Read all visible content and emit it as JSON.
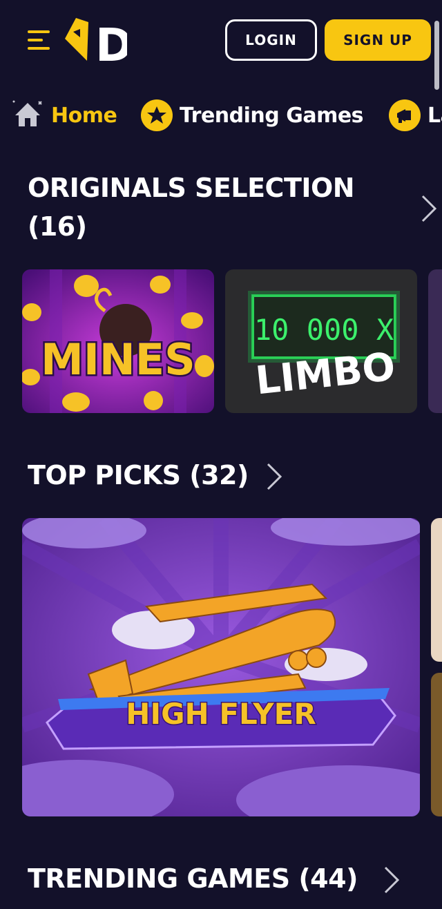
{
  "header": {
    "logo_letter": "D",
    "login_label": "LOGIN",
    "signup_label": "SIGN UP"
  },
  "nav": {
    "items": [
      {
        "label": "Home",
        "icon": "home-icon",
        "active": true
      },
      {
        "label": "Trending Games",
        "icon": "star-icon",
        "active": false
      },
      {
        "label": "La",
        "icon": "megaphone-icon",
        "active": false
      }
    ]
  },
  "sections": {
    "originals": {
      "title_line1": "ORIGINALS SELECTION",
      "title_line2": "(16)"
    },
    "top_picks": {
      "title": "TOP PICKS (32)"
    },
    "trending": {
      "title": "TRENDING GAMES (44)"
    }
  },
  "games": {
    "mines": {
      "title": "MINES"
    },
    "limbo": {
      "title": "LIMBO",
      "multiplier": "10 000 X"
    },
    "high_flyer": {
      "title": "HIGH FLYER"
    }
  },
  "colors": {
    "background": "#13112a",
    "accent": "#f8c611",
    "text": "#ffffff"
  }
}
